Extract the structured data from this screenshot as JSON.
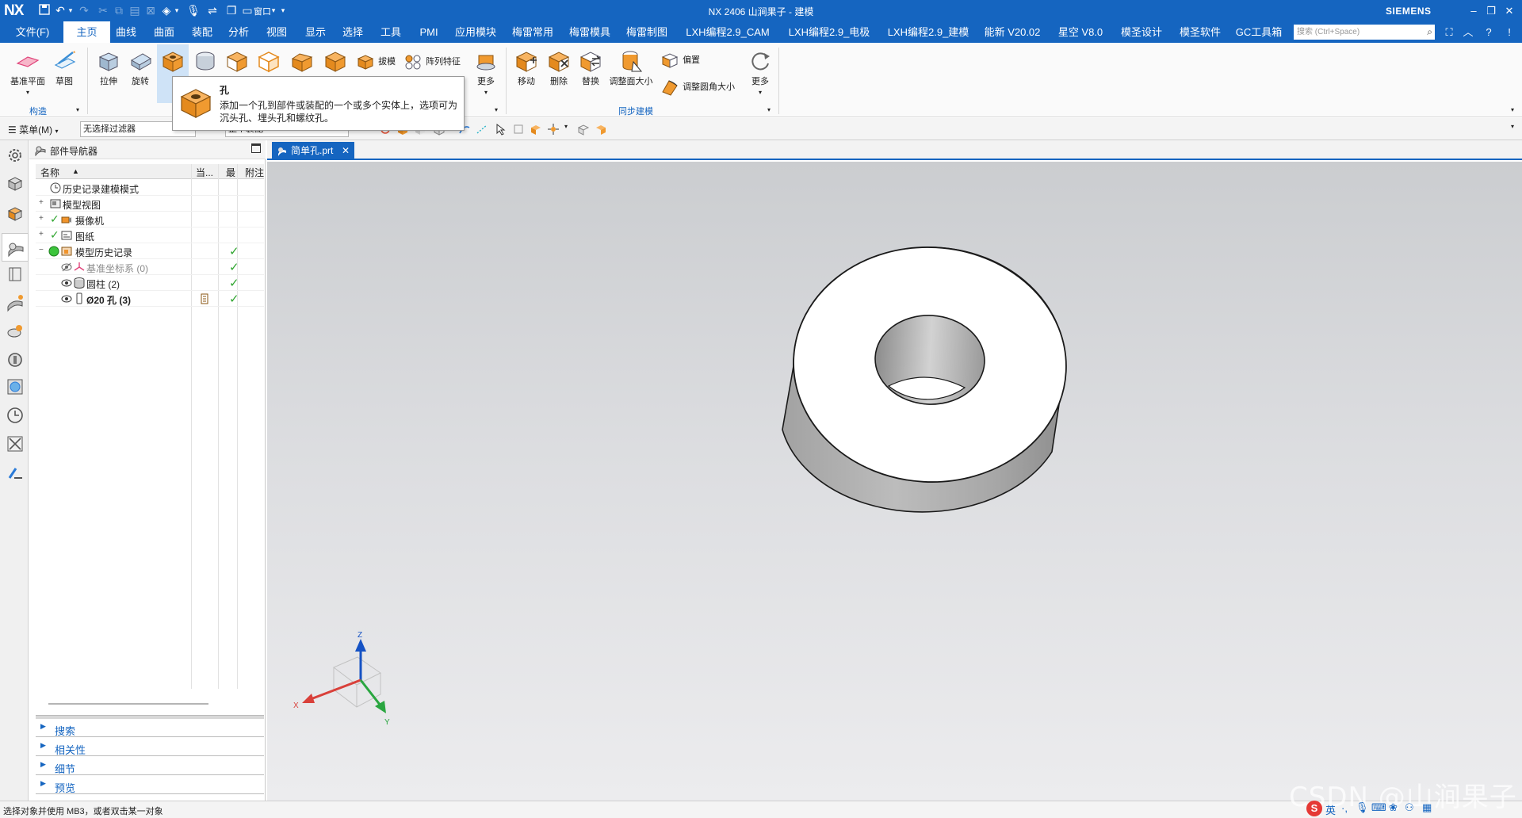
{
  "window": {
    "logo": "NX",
    "title": "NX 2406 山涧果子 - 建模",
    "brand": "SIEMENS"
  },
  "menu_tabs": [
    "文件(F)",
    "主页",
    "曲线",
    "曲面",
    "装配",
    "分析",
    "视图",
    "显示",
    "选择",
    "工具",
    "PMI",
    "应用模块",
    "梅雷常用",
    "梅雷模具",
    "梅雷制图",
    "LXH编程2.9_CAM",
    "LXH编程2.9_电极",
    "LXH编程2.9_建模",
    "能新 V20.02",
    "星空 V8.0",
    "模圣设计",
    "模圣软件",
    "GC工具箱"
  ],
  "active_tab": "主页",
  "quick_access": {
    "window_menu": "窗口"
  },
  "search": {
    "placeholder": "搜索 (Ctrl+Space)"
  },
  "ribbon": {
    "construct": {
      "datum_plane": "基准平面",
      "sketch": "草图",
      "group_label": "构造"
    },
    "features": {
      "extrude": "拉伸",
      "revolve": "旋转",
      "draft": "拔模",
      "pattern": "阵列特征",
      "more": "更多"
    },
    "sync": {
      "move": "移动",
      "delete": "删除",
      "replace": "替换",
      "resize_face": "调整面大小",
      "offset": "偏置",
      "resize_blend": "调整圆角大小",
      "more": "更多",
      "group_label": "同步建模"
    }
  },
  "tooltip": {
    "title": "孔",
    "description": "添加一个孔到部件或装配的一个或多个实体上，选项可为沉头孔、埋头孔和螺纹孔。"
  },
  "selection_bar": {
    "menu": "菜单(M)",
    "filter": "无选择过滤器",
    "scope": "整个装配"
  },
  "navigator": {
    "title": "部件导航器",
    "columns": {
      "name": "名称",
      "current": "当...",
      "latest": "最",
      "notes": "附注"
    },
    "rows": [
      {
        "label": "历史记录建模模式",
        "expander": "",
        "check": ""
      },
      {
        "label": "模型视图",
        "expander": "+",
        "check": ""
      },
      {
        "label": "摄像机",
        "expander": "+",
        "check": ""
      },
      {
        "label": "图纸",
        "expander": "+",
        "check": ""
      },
      {
        "label": "模型历史记录",
        "expander": "−",
        "check": "✓"
      },
      {
        "label": "基准坐标系 (0)",
        "expander": "",
        "check": "✓"
      },
      {
        "label": "圆柱 (2)",
        "expander": "",
        "check": "✓"
      },
      {
        "label": "Ø20 孔 (3)",
        "expander": "",
        "check": "✓"
      }
    ],
    "panels": [
      "搜索",
      "相关性",
      "细节",
      "预览"
    ]
  },
  "document_tab": "简单孔.prt",
  "triad": {
    "x": "X",
    "y": "Y",
    "z": "Z"
  },
  "status": {
    "message": "选择对象并使用 MB3，或者双击某一对象"
  },
  "watermark": "CSDN @山涧果子",
  "tray": {
    "ime": "英"
  },
  "colors": {
    "accent": "#1565c0",
    "feature_orange": "#f0932b",
    "check_green": "#2fa52f"
  }
}
